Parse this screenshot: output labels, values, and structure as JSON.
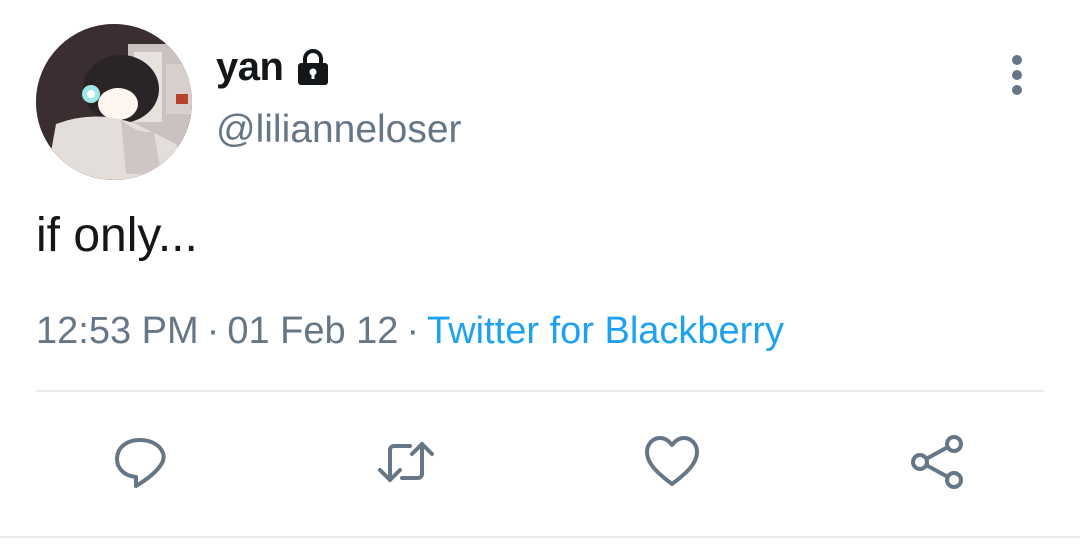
{
  "author": {
    "display_name": "yan",
    "handle": "@lilianneloser",
    "protected_icon": "lock-icon",
    "avatar": "profile-photo"
  },
  "tweet": {
    "text": "if only...",
    "time": "12:53 PM",
    "date": "01 Feb 12",
    "separator": "·",
    "source": "Twitter for Blackberry"
  },
  "menu": {
    "icon": "more-vertical-icon"
  },
  "actions": [
    {
      "name": "reply",
      "icon": "reply-icon"
    },
    {
      "name": "retweet",
      "icon": "retweet-icon"
    },
    {
      "name": "like",
      "icon": "heart-icon"
    },
    {
      "name": "share",
      "icon": "share-icon"
    }
  ],
  "colors": {
    "text_primary": "#14171a",
    "text_secondary": "#657786",
    "link": "#1da1f2",
    "divider": "#e6ecf0"
  }
}
